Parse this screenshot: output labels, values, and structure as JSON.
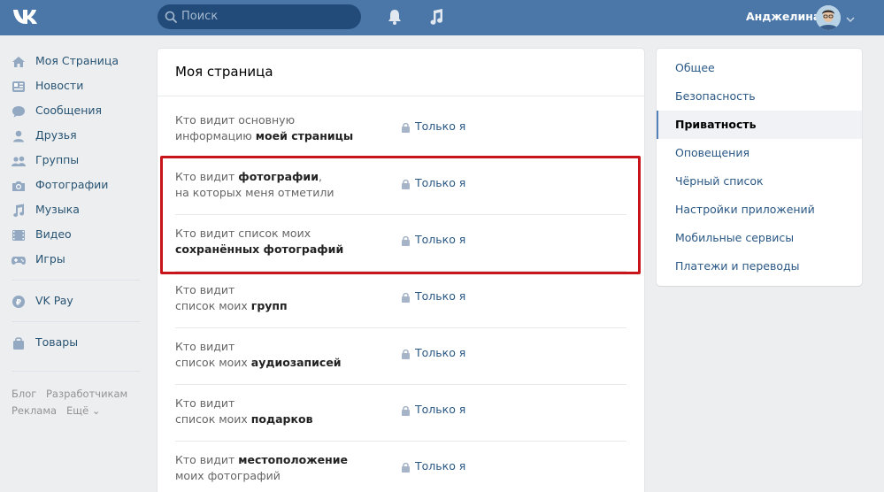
{
  "header": {
    "search_placeholder": "Поиск",
    "user_name": "Анджелина"
  },
  "sidebar": {
    "items": [
      {
        "label": "Моя Страница",
        "icon": "home-icon"
      },
      {
        "label": "Новости",
        "icon": "news-icon"
      },
      {
        "label": "Сообщения",
        "icon": "messages-icon"
      },
      {
        "label": "Друзья",
        "icon": "friends-icon"
      },
      {
        "label": "Группы",
        "icon": "groups-icon"
      },
      {
        "label": "Фотографии",
        "icon": "photos-icon"
      },
      {
        "label": "Музыка",
        "icon": "music-icon"
      },
      {
        "label": "Видео",
        "icon": "video-icon"
      },
      {
        "label": "Игры",
        "icon": "games-icon"
      }
    ],
    "vkpay": "VK Pay",
    "goods": "Товары",
    "footer": {
      "blog": "Блог",
      "developers": "Разработчикам",
      "ads": "Реклама",
      "more": "Ещё"
    }
  },
  "main": {
    "title": "Моя страница",
    "rows": [
      {
        "line1_pre": "Кто видит основную",
        "line1_bold": "",
        "line1_post": "",
        "line2_pre": "информацию ",
        "line2_bold": "моей страницы",
        "value": "Только я"
      },
      {
        "line1_pre": "Кто видит ",
        "line1_bold": "фотографии",
        "line1_post": ",",
        "line2_pre": "на которых меня отметили",
        "line2_bold": "",
        "value": "Только я"
      },
      {
        "line1_pre": "Кто видит список моих",
        "line1_bold": "",
        "line1_post": "",
        "line2_pre": "",
        "line2_bold": "сохранённых фотографий",
        "value": "Только я"
      },
      {
        "line1_pre": "Кто видит",
        "line1_bold": "",
        "line1_post": "",
        "line2_pre": "список моих ",
        "line2_bold": "групп",
        "value": "Только я"
      },
      {
        "line1_pre": "Кто видит",
        "line1_bold": "",
        "line1_post": "",
        "line2_pre": "список моих ",
        "line2_bold": "аудиозаписей",
        "value": "Только я"
      },
      {
        "line1_pre": "Кто видит",
        "line1_bold": "",
        "line1_post": "",
        "line2_pre": "список моих ",
        "line2_bold": "подарков",
        "value": "Только я"
      },
      {
        "line1_pre": "Кто видит ",
        "line1_bold": "местоположение",
        "line1_post": "",
        "line2_pre": "моих фотографий",
        "line2_bold": "",
        "value": "Только я"
      }
    ]
  },
  "settings_menu": {
    "items": [
      {
        "label": "Общее"
      },
      {
        "label": "Безопасность"
      },
      {
        "label": "Приватность"
      },
      {
        "label": "Оповещения"
      },
      {
        "label": "Чёрный список"
      },
      {
        "label": "Настройки приложений"
      },
      {
        "label": "Мобильные сервисы"
      },
      {
        "label": "Платежи и переводы"
      }
    ],
    "active_index": 2
  },
  "colors": {
    "header_bg": "#4a76a8",
    "link": "#2a5885",
    "highlight_border": "#c8151c",
    "page_bg": "#edeef0"
  }
}
